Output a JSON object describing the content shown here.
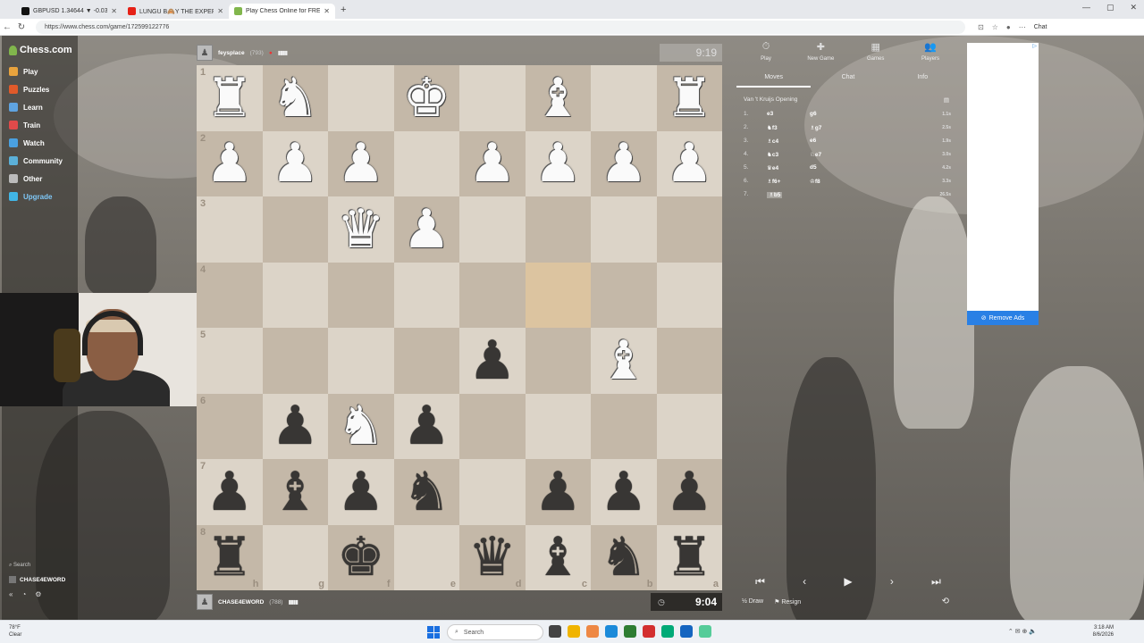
{
  "browser": {
    "tabs": [
      {
        "label": "GBPUSD 1.34644 ▼ -0.03% $100@",
        "icon": "tradingview-icon",
        "color": "#111111"
      },
      {
        "label": "LUNGU B🙈Y THE EXPERIENCE",
        "icon": "youtube-icon",
        "color": "#e62117"
      },
      {
        "label": "Play Chess Online for FREE - 2 Play",
        "icon": "chess-icon",
        "color": "#81b64c"
      }
    ],
    "url": "https://www.chess.com/game/172599122776",
    "chat_label": "Chat"
  },
  "sidebar": {
    "logo": "Chess.com",
    "items": [
      {
        "label": "Play",
        "color": "#e8a33d"
      },
      {
        "label": "Puzzles",
        "color": "#e05a2a"
      },
      {
        "label": "Learn",
        "color": "#5fa3e0"
      },
      {
        "label": "Train",
        "color": "#e04a4a"
      },
      {
        "label": "Watch",
        "color": "#4aa0e0"
      },
      {
        "label": "Community",
        "color": "#5bb0d8"
      },
      {
        "label": "Other",
        "color": "#bbbbbb"
      },
      {
        "label": "Upgrade",
        "color": "#41b6e6"
      }
    ],
    "search": "Search",
    "username": "CHASE4EWORD"
  },
  "game": {
    "top_player": {
      "name": "feysplace",
      "rating": "(793)",
      "clock": "9:19"
    },
    "bottom_player": {
      "name": "CHASE4EWORD",
      "rating": "(788)",
      "clock": "9:04"
    },
    "ranks": [
      "1",
      "2",
      "3",
      "4",
      "5",
      "6",
      "7",
      "8"
    ],
    "files": [
      "h",
      "g",
      "f",
      "e",
      "d",
      "c",
      "b",
      "a"
    ],
    "board": [
      [
        "R",
        "N",
        "",
        "K",
        "",
        "B",
        "",
        "R"
      ],
      [
        "P",
        "P",
        "P",
        "",
        "P",
        "P",
        "P",
        "P"
      ],
      [
        "",
        "",
        "Q",
        "P",
        "",
        "",
        "",
        ""
      ],
      [
        "",
        "",
        "",
        "",
        "",
        "",
        "",
        ""
      ],
      [
        "",
        "",
        "",
        "",
        "p",
        "",
        "B",
        ""
      ],
      [
        "",
        "p",
        "N",
        "p",
        "",
        "",
        "",
        ""
      ],
      [
        "p",
        "b",
        "p",
        "n",
        "",
        "p",
        "p",
        "p"
      ],
      [
        "r",
        "",
        "k",
        "",
        "q",
        "b",
        "n",
        "r"
      ]
    ],
    "highlight": [
      [
        3,
        5
      ]
    ]
  },
  "panel": {
    "tabs": [
      {
        "label": "Play",
        "icon": "stopwatch-icon"
      },
      {
        "label": "New Game",
        "icon": "plus-icon"
      },
      {
        "label": "Games",
        "icon": "grid-icon"
      },
      {
        "label": "Players",
        "icon": "players-icon"
      }
    ],
    "subtabs": [
      "Moves",
      "Chat",
      "Info"
    ],
    "opening": "Van 't Kruijs Opening",
    "moves": [
      {
        "n": "1.",
        "w": "e3",
        "b": "g6",
        "t": "1.1s"
      },
      {
        "n": "2.",
        "w": "♞f3",
        "b": "♗g7",
        "t": "2.5s"
      },
      {
        "n": "3.",
        "w": "♗c4",
        "b": "e6",
        "t": "1.9s"
      },
      {
        "n": "4.",
        "w": "♞c3",
        "b": "♘e7",
        "t": "3.0s"
      },
      {
        "n": "5.",
        "w": "♛e4",
        "b": "d5",
        "t": "4.2s"
      },
      {
        "n": "6.",
        "w": "♗f6+",
        "b": "♔f8",
        "t": "3.3s"
      },
      {
        "n": "7.",
        "w": "♗b5",
        "b": "",
        "t": "26.5s"
      }
    ],
    "controls": [
      "⏮",
      "‹",
      "▶",
      "›",
      "⏭"
    ],
    "draw": "½ Draw",
    "resign": "Resign"
  },
  "ad": {
    "remove": "Remove Ads"
  },
  "taskbar": {
    "temp": "78°F",
    "weather": "Clear",
    "search": "Search",
    "time": "3:18 AM",
    "date": "8/6/2026"
  }
}
